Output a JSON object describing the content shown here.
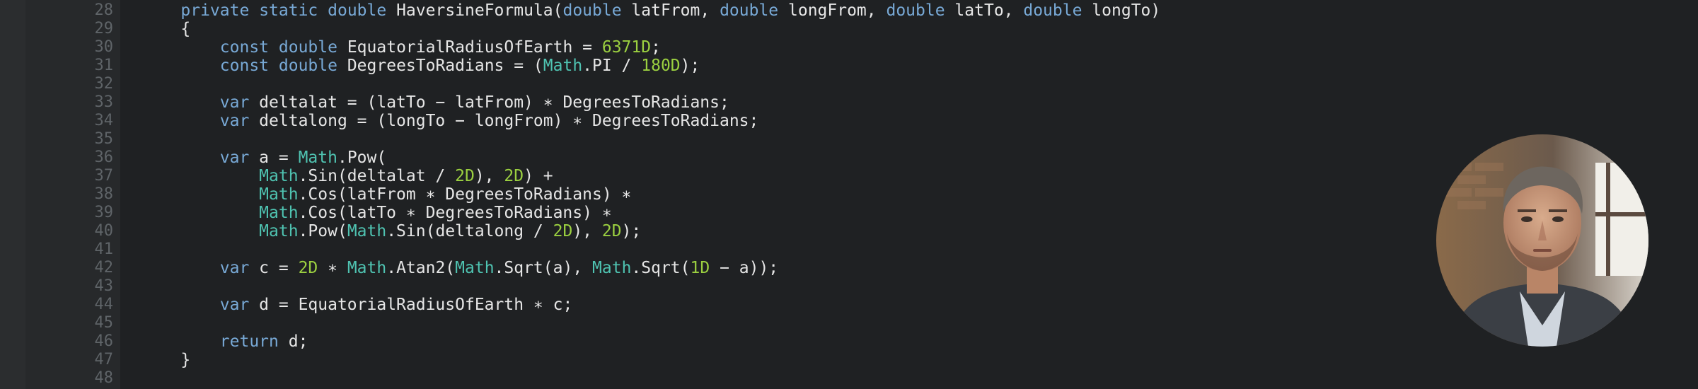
{
  "editor": {
    "line_numbers": [
      "28",
      "29",
      "30",
      "31",
      "32",
      "33",
      "34",
      "35",
      "36",
      "37",
      "38",
      "39",
      "40",
      "41",
      "42",
      "43",
      "44",
      "45",
      "46",
      "47",
      "48"
    ],
    "lines": [
      {
        "indent": "    ",
        "tokens": [
          [
            "kw",
            "private"
          ],
          [
            "plain",
            " "
          ],
          [
            "kw",
            "static"
          ],
          [
            "plain",
            " "
          ],
          [
            "kw",
            "double"
          ],
          [
            "plain",
            " HaversineFormula("
          ],
          [
            "kw",
            "double"
          ],
          [
            "plain",
            " latFrom, "
          ],
          [
            "kw",
            "double"
          ],
          [
            "plain",
            " longFrom, "
          ],
          [
            "kw",
            "double"
          ],
          [
            "plain",
            " latTo, "
          ],
          [
            "kw",
            "double"
          ],
          [
            "plain",
            " longTo)"
          ]
        ]
      },
      {
        "indent": "    ",
        "tokens": [
          [
            "plain",
            "{"
          ]
        ]
      },
      {
        "indent": "        ",
        "tokens": [
          [
            "kw",
            "const"
          ],
          [
            "plain",
            " "
          ],
          [
            "kw",
            "double"
          ],
          [
            "plain",
            " EquatorialRadiusOfEarth = "
          ],
          [
            "num",
            "6371D"
          ],
          [
            "plain",
            ";"
          ]
        ]
      },
      {
        "indent": "        ",
        "tokens": [
          [
            "kw",
            "const"
          ],
          [
            "plain",
            " "
          ],
          [
            "kw",
            "double"
          ],
          [
            "plain",
            " DegreesToRadians = ("
          ],
          [
            "cls",
            "Math"
          ],
          [
            "plain",
            ".PI / "
          ],
          [
            "num",
            "180D"
          ],
          [
            "plain",
            ");"
          ]
        ]
      },
      {
        "indent": "",
        "tokens": []
      },
      {
        "indent": "        ",
        "tokens": [
          [
            "kw",
            "var"
          ],
          [
            "plain",
            " deltalat = (latTo − latFrom) ∗ DegreesToRadians;"
          ]
        ]
      },
      {
        "indent": "        ",
        "tokens": [
          [
            "kw",
            "var"
          ],
          [
            "plain",
            " deltalong = (longTo − longFrom) ∗ DegreesToRadians;"
          ]
        ]
      },
      {
        "indent": "",
        "tokens": []
      },
      {
        "indent": "        ",
        "tokens": [
          [
            "kw",
            "var"
          ],
          [
            "plain",
            " a = "
          ],
          [
            "cls",
            "Math"
          ],
          [
            "plain",
            ".Pow("
          ]
        ]
      },
      {
        "indent": "            ",
        "tokens": [
          [
            "cls",
            "Math"
          ],
          [
            "plain",
            ".Sin(deltalat / "
          ],
          [
            "num",
            "2D"
          ],
          [
            "plain",
            "), "
          ],
          [
            "num",
            "2D"
          ],
          [
            "plain",
            ") +"
          ]
        ]
      },
      {
        "indent": "            ",
        "tokens": [
          [
            "cls",
            "Math"
          ],
          [
            "plain",
            ".Cos(latFrom ∗ DegreesToRadians) ∗"
          ]
        ]
      },
      {
        "indent": "            ",
        "tokens": [
          [
            "cls",
            "Math"
          ],
          [
            "plain",
            ".Cos(latTo ∗ DegreesToRadians) ∗"
          ]
        ]
      },
      {
        "indent": "            ",
        "tokens": [
          [
            "cls",
            "Math"
          ],
          [
            "plain",
            ".Pow("
          ],
          [
            "cls",
            "Math"
          ],
          [
            "plain",
            ".Sin(deltalong / "
          ],
          [
            "num",
            "2D"
          ],
          [
            "plain",
            "), "
          ],
          [
            "num",
            "2D"
          ],
          [
            "plain",
            ");"
          ]
        ]
      },
      {
        "indent": "",
        "tokens": []
      },
      {
        "indent": "        ",
        "tokens": [
          [
            "kw",
            "var"
          ],
          [
            "plain",
            " c = "
          ],
          [
            "num",
            "2D"
          ],
          [
            "plain",
            " ∗ "
          ],
          [
            "cls",
            "Math"
          ],
          [
            "plain",
            ".Atan2("
          ],
          [
            "cls",
            "Math"
          ],
          [
            "plain",
            ".Sqrt(a), "
          ],
          [
            "cls",
            "Math"
          ],
          [
            "plain",
            ".Sqrt("
          ],
          [
            "num",
            "1D"
          ],
          [
            "plain",
            " − a));"
          ]
        ]
      },
      {
        "indent": "",
        "tokens": []
      },
      {
        "indent": "        ",
        "tokens": [
          [
            "kw",
            "var"
          ],
          [
            "plain",
            " d = EquatorialRadiusOfEarth ∗ c;"
          ]
        ]
      },
      {
        "indent": "",
        "tokens": []
      },
      {
        "indent": "        ",
        "tokens": [
          [
            "kw",
            "return"
          ],
          [
            "plain",
            " d;"
          ]
        ]
      },
      {
        "indent": "    ",
        "tokens": [
          [
            "plain",
            "}"
          ]
        ]
      },
      {
        "indent": "",
        "tokens": []
      }
    ]
  },
  "colors": {
    "keyword": "#78a9d6",
    "class": "#4fc3b1",
    "number": "#9bd040",
    "text": "#e6e6e6",
    "gutter_text": "#5f6468",
    "background": "#1f2123"
  },
  "avatar": {
    "icon": "presenter-avatar"
  }
}
